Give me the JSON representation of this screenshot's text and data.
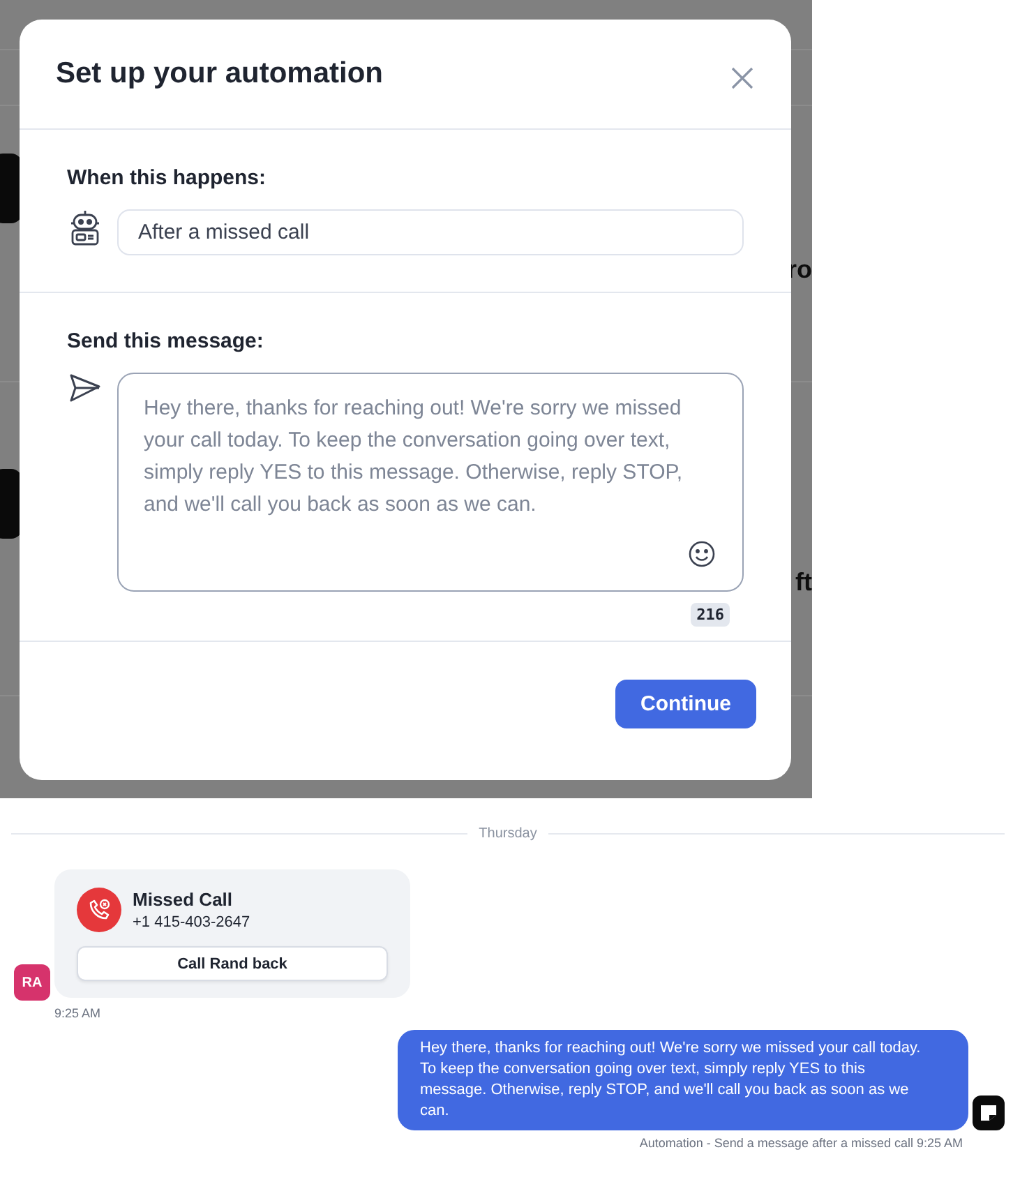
{
  "background": {
    "fragment_rows": [
      {
        "right": "ro"
      },
      {
        "right": "ft"
      }
    ]
  },
  "modal": {
    "title": "Set up your automation",
    "trigger": {
      "label": "When this happens:",
      "value": "After a missed call"
    },
    "message": {
      "label": "Send this message:",
      "placeholder": "Hey there, thanks for reaching out! We're sorry we missed your call today. To keep the conversation going over text, simply reply YES to this message. Otherwise, reply STOP, and we'll call you back as soon as we can.",
      "count": "216"
    },
    "button": "Continue"
  },
  "chat": {
    "date": "Thursday",
    "missed_call": {
      "title": "Missed Call",
      "number": "+1 415-403-2647",
      "button": "Call Rand back",
      "avatar": "RA",
      "time": "9:25 AM"
    },
    "outgoing": {
      "text": "Hey there, thanks for reaching out! We're sorry we missed your call today. To keep the conversation going over text, simply reply YES to this message. Otherwise, reply STOP, and we'll call you back as soon as we can.",
      "caption": "Automation - Send a message after a missed call 9:25 AM"
    }
  }
}
